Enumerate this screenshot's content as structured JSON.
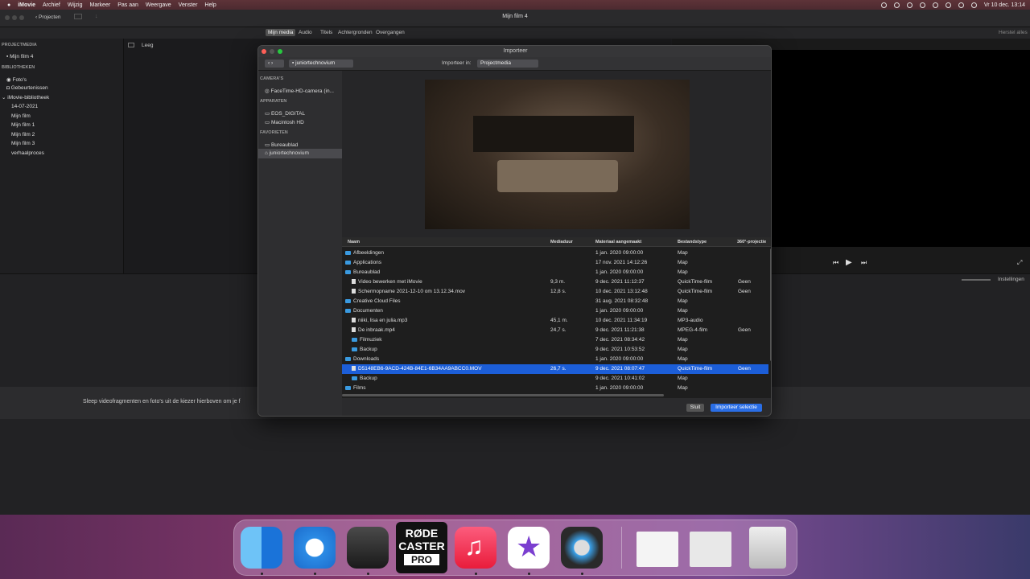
{
  "menubar": {
    "app": "iMovie",
    "items": [
      "Archief",
      "Wijzig",
      "Markeer",
      "Pas aan",
      "Weergave",
      "Venster",
      "Help"
    ],
    "clock": "Vr 10 dec.  13:14"
  },
  "window": {
    "title": "Mijn film 4",
    "back_label": "Projecten",
    "tabs": [
      "Mijn media",
      "Audio",
      "Titels",
      "Achtergronden",
      "Overgangen"
    ],
    "reset_label": "Herstel alles"
  },
  "sidebar": {
    "projectmedia_header": "PROJECTMEDIA",
    "project": "Mijn film 4",
    "libraries_header": "BIBLIOTHEKEN",
    "items": [
      "Foto's",
      "Gebeurtenissen",
      "iMovie-bibliotheek",
      "14-07-2021",
      "Mijn film",
      "Mijn film 1",
      "Mijn film 2",
      "Mijn film 3",
      "verhaalproces"
    ]
  },
  "browser": {
    "label": "Leeg"
  },
  "timeline": {
    "hint": "Sleep videofragmenten en foto's uit de kiezer hierboven om je f",
    "settings": "Instellingen"
  },
  "dialog": {
    "title": "Importeer",
    "location": "juniortechnovium",
    "import_in_label": "Importeer in:",
    "import_in_value": "Projectmedia",
    "sections": {
      "camera": "CAMERA'S",
      "camera_items": [
        "FaceTime-HD-camera (in..."
      ],
      "devices": "APPARATEN",
      "device_items": [
        "EOS_DIGITAL",
        "Macintosh HD"
      ],
      "favorites": "FAVORIETEN",
      "favorite_items": [
        "Bureaublad",
        "juniortechnovium"
      ]
    },
    "columns": [
      "Naam",
      "Mediaduur",
      "Materiaal aangemaakt",
      "Bestandstype",
      "360°-projectie"
    ],
    "rows": [
      {
        "name": "Afbeeldingen",
        "dur": "",
        "date": "1 jan. 2020 09:00:00",
        "type": "Map",
        "p": "",
        "kind": "folder",
        "indent": 0
      },
      {
        "name": "Applications",
        "dur": "",
        "date": "17 nov. 2021 14:12:26",
        "type": "Map",
        "p": "",
        "kind": "folder",
        "indent": 0
      },
      {
        "name": "Bureaublad",
        "dur": "",
        "date": "1 jan. 2020 09:00:00",
        "type": "Map",
        "p": "",
        "kind": "folder",
        "indent": 0
      },
      {
        "name": "Video bewerken met iMovie",
        "dur": "9,3 m.",
        "date": "9 dec. 2021 11:12:37",
        "type": "QuickTime-film",
        "p": "Geen",
        "kind": "file",
        "indent": 1
      },
      {
        "name": "Schermopname 2021-12-10 om 13.12.34.mov",
        "dur": "12,8 s.",
        "date": "10 dec. 2021 13:12:48",
        "type": "QuickTime-film",
        "p": "Geen",
        "kind": "file",
        "indent": 1
      },
      {
        "name": "Creative Cloud Files",
        "dur": "",
        "date": "31 aug. 2021 08:32:48",
        "type": "Map",
        "p": "",
        "kind": "folder",
        "indent": 0
      },
      {
        "name": "Documenten",
        "dur": "",
        "date": "1 jan. 2020 09:00:00",
        "type": "Map",
        "p": "",
        "kind": "folder",
        "indent": 0
      },
      {
        "name": "niiki, lisa en julia.mp3",
        "dur": "45,1 m.",
        "date": "10 dec. 2021 11:34:19",
        "type": "MP3-audio",
        "p": "",
        "kind": "file",
        "indent": 1
      },
      {
        "name": "De inbraak.mp4",
        "dur": "24,7 s.",
        "date": "9 dec. 2021 11:21:38",
        "type": "MPEG-4-film",
        "p": "Geen",
        "kind": "file",
        "indent": 1
      },
      {
        "name": "Filmuziek",
        "dur": "",
        "date": "7 dec. 2021 08:34:42",
        "type": "Map",
        "p": "",
        "kind": "folder",
        "indent": 1
      },
      {
        "name": "Backup",
        "dur": "",
        "date": "9 dec. 2021 10:53:52",
        "type": "Map",
        "p": "",
        "kind": "folder",
        "indent": 1
      },
      {
        "name": "Downloads",
        "dur": "",
        "date": "1 jan. 2020 09:00:00",
        "type": "Map",
        "p": "",
        "kind": "folder",
        "indent": 0
      },
      {
        "name": "D5148EB6-9ACD-424B-84E1-6B34AA9ABCC0.MOV",
        "dur": "26,7 s.",
        "date": "9 dec. 2021 08:07:47",
        "type": "QuickTime-film",
        "p": "Geen",
        "kind": "file",
        "indent": 1,
        "selected": true
      },
      {
        "name": "Backup",
        "dur": "",
        "date": "9 dec. 2021 10:41:02",
        "type": "Map",
        "p": "",
        "kind": "folder",
        "indent": 1
      },
      {
        "name": "Films",
        "dur": "",
        "date": "1 jan. 2020 09:00:00",
        "type": "Map",
        "p": "",
        "kind": "folder",
        "indent": 0
      }
    ],
    "close_label": "Sluit",
    "import_label": "Importeer selectie"
  },
  "dock": {
    "apps": [
      "finder-icon",
      "safari-icon",
      "garageband-icon",
      "rodecaster-icon",
      "music-icon",
      "imovie-icon",
      "quicktime-icon"
    ],
    "rode_text": [
      "RØDE",
      "CASTER",
      "PRO"
    ]
  }
}
